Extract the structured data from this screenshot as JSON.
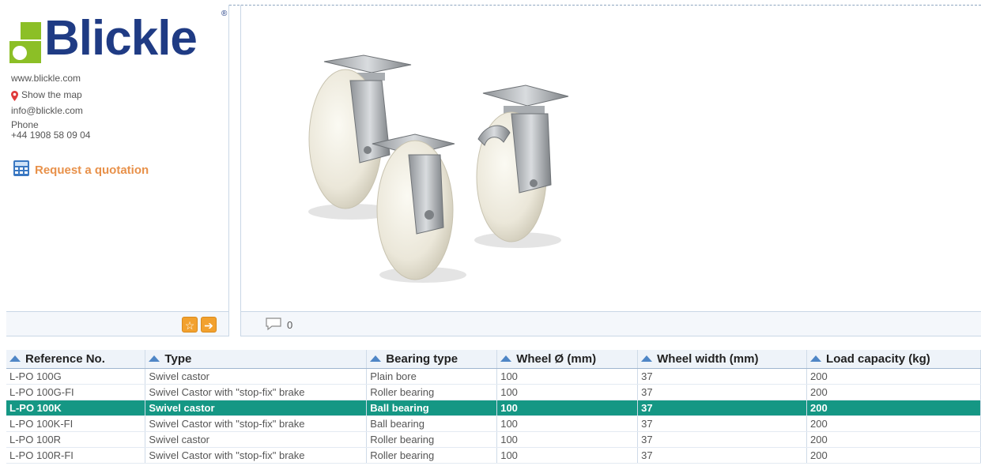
{
  "brand": {
    "name": "Blickle",
    "registered": "®",
    "green": "#8cbf26",
    "blue": "#1f3b84"
  },
  "contact": {
    "website": "www.blickle.com",
    "map_label": "Show the map",
    "email": "info@blickle.com",
    "phone_label": "Phone",
    "phone": "+44 1908 58 09 04",
    "quote_label": "Request a quotation"
  },
  "footer": {
    "comment_count": "0"
  },
  "icons": [
    "map-pin-icon",
    "calculator-icon",
    "star-icon",
    "arrow-right-icon",
    "comment-icon",
    "sort-asc-icon"
  ],
  "table": {
    "headers": [
      "Reference No.",
      "Type",
      "Bearing type",
      "Wheel Ø (mm)",
      "Wheel width (mm)",
      "Load capacity (kg)"
    ],
    "selected_color": "#159784",
    "rows": [
      [
        "L-PO 100G",
        "Swivel castor",
        "Plain bore",
        "100",
        "37",
        "200"
      ],
      [
        "L-PO 100G-FI",
        "Swivel Castor with \"stop-fix\" brake",
        "Roller bearing",
        "100",
        "37",
        "200"
      ],
      [
        "L-PO 100K",
        "Swivel castor",
        "Ball bearing",
        "100",
        "37",
        "200"
      ],
      [
        "L-PO 100K-FI",
        "Swivel Castor with \"stop-fix\" brake",
        "Ball bearing",
        "100",
        "37",
        "200"
      ],
      [
        "L-PO 100R",
        "Swivel castor",
        "Roller bearing",
        "100",
        "37",
        "200"
      ],
      [
        "L-PO 100R-FI",
        "Swivel Castor with \"stop-fix\" brake",
        "Roller bearing",
        "100",
        "37",
        "200"
      ]
    ]
  }
}
